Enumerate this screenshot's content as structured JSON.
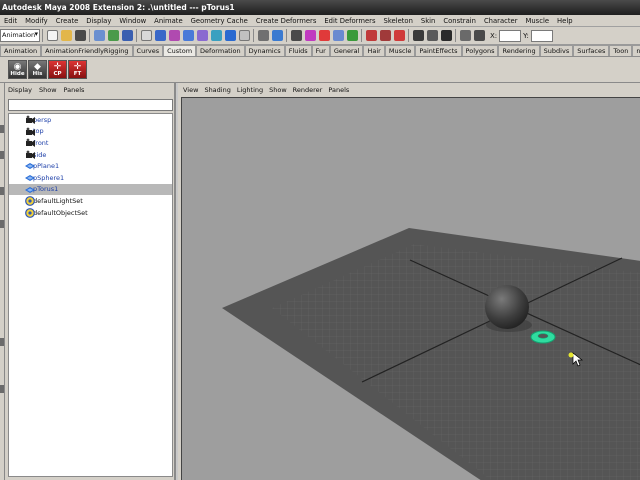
{
  "window": {
    "title": "Autodesk Maya 2008 Extension 2: .\\untitled  ---  pTorus1"
  },
  "menubar": [
    "Edit",
    "Modify",
    "Create",
    "Display",
    "Window",
    "Animate",
    "Geometry Cache",
    "Create Deformers",
    "Edit Deformers",
    "Skeleton",
    "Skin",
    "Constrain",
    "Character",
    "Muscle",
    "Help"
  ],
  "statusline": {
    "mode": "Animation",
    "x_label": "X:",
    "y_label": "Y:"
  },
  "shelf_tabs": [
    "Animation",
    "AnimationFriendlyRigging",
    "Curves",
    "Custom",
    "Deformation",
    "Dynamics",
    "Fluids",
    "Fur",
    "General",
    "Hair",
    "Muscle",
    "PaintEffects",
    "Polygons",
    "Rendering",
    "Subdivs",
    "Surfaces",
    "Toon",
    "nCloth"
  ],
  "shelf_active_tab": "Custom",
  "shelf_buttons": [
    {
      "label": "Hide",
      "icon": "hide-icon"
    },
    {
      "label": "His",
      "icon": "history-icon"
    },
    {
      "label": "CP",
      "icon": "center-pivot-icon"
    },
    {
      "label": "FT",
      "icon": "freeze-transform-icon"
    }
  ],
  "outliner": {
    "menu": [
      "Display",
      "Show",
      "Panels"
    ],
    "items": [
      {
        "name": "persp",
        "type": "camera"
      },
      {
        "name": "top",
        "type": "camera"
      },
      {
        "name": "front",
        "type": "camera"
      },
      {
        "name": "side",
        "type": "camera"
      },
      {
        "name": "pPlane1",
        "type": "mesh"
      },
      {
        "name": "pSphere1",
        "type": "mesh"
      },
      {
        "name": "pTorus1",
        "type": "mesh",
        "selected": true
      },
      {
        "name": "defaultLightSet",
        "type": "set"
      },
      {
        "name": "defaultObjectSet",
        "type": "set"
      }
    ]
  },
  "viewport": {
    "menu": [
      "View",
      "Shading",
      "Lighting",
      "Show",
      "Renderer",
      "Panels"
    ]
  },
  "colors": {
    "viewport_bg": "#9e9e9e",
    "plane": "#555555",
    "selection": "#2fdca0",
    "title_bg": "#2a2a2a"
  }
}
